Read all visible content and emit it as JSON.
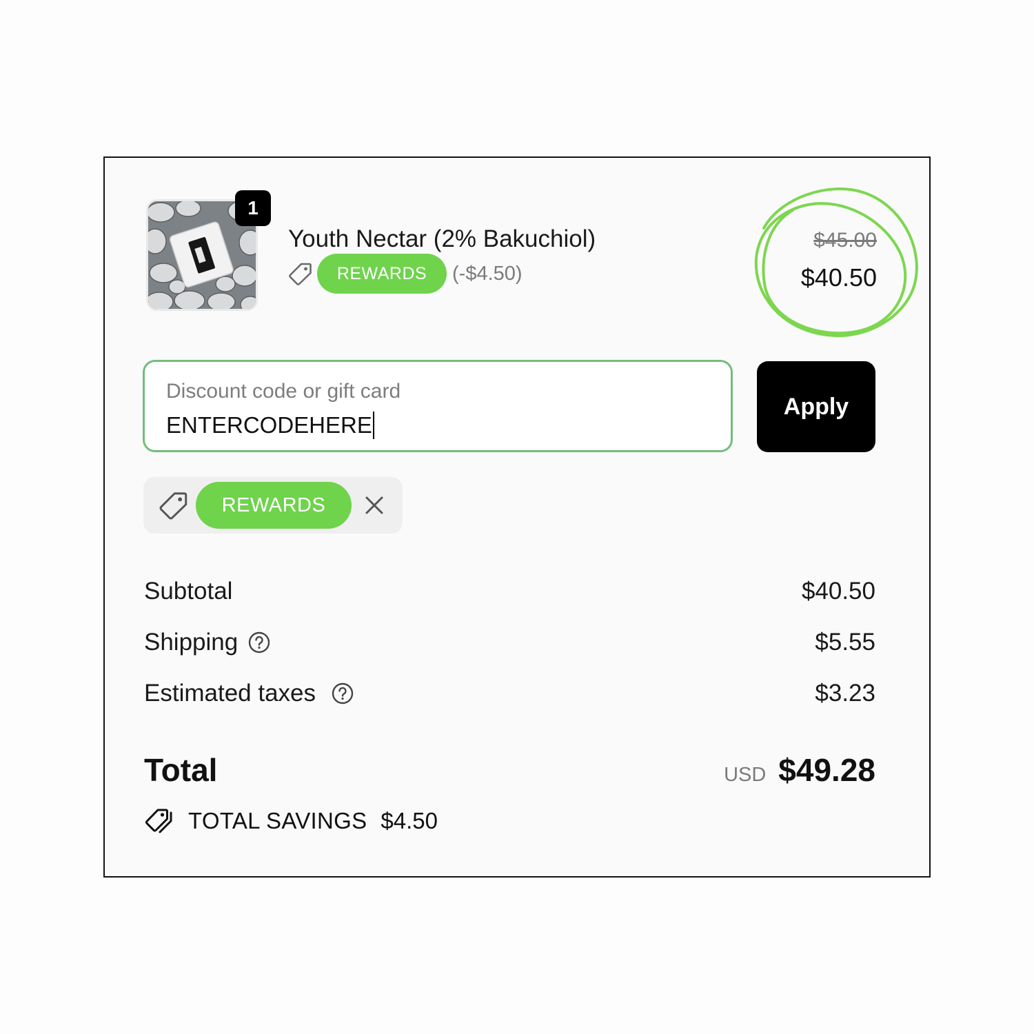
{
  "product": {
    "quantity": "1",
    "name": "Youth Nectar (2% Bakuchiol)",
    "discount_code": "REWARDS",
    "discount_amount": "(-$4.50)",
    "original_price": "$45.00",
    "price": "$40.50",
    "image": "product-photo-bottle-on-pebbles"
  },
  "discount_field": {
    "label": "Discount code or gift card",
    "value": "ENTERCODEHERE"
  },
  "apply_button": "Apply",
  "applied_code": {
    "label": "REWARDS"
  },
  "summary": {
    "subtotal_label": "Subtotal",
    "subtotal_value": "$40.50",
    "shipping_label": "Shipping",
    "shipping_value": "$5.55",
    "taxes_label": "Estimated taxes",
    "taxes_value": "$3.23",
    "total_label": "Total",
    "currency": "USD",
    "total_value": "$49.28",
    "savings_label": "TOTAL SAVINGS",
    "savings_value": "$4.50"
  },
  "colors": {
    "accent_green": "#6fd34b",
    "field_border": "#72bd7a",
    "button_bg": "#000000"
  },
  "icons": [
    "tag-icon",
    "close-icon",
    "help-circle-icon",
    "savings-tags-icon"
  ]
}
